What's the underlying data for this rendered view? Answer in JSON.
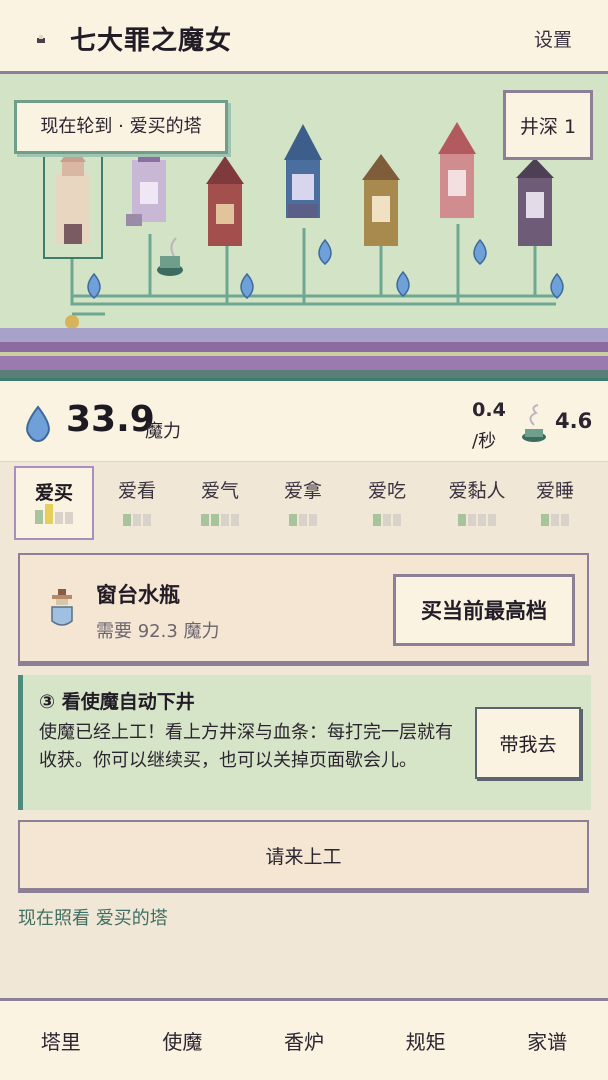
{
  "header": {
    "title": "七大罪之魔女",
    "settings_label": "设置"
  },
  "scene": {
    "turn_label": "现在轮到 · 爱买的塔",
    "depth_label": "井深 1"
  },
  "resources": {
    "mana_value": "33.9",
    "mana_unit": "魔力",
    "rate_value": "0.4",
    "rate_unit": "/秒",
    "incense_value": "4.6"
  },
  "tabs": [
    {
      "label": "爱买",
      "active": true
    },
    {
      "label": "爱看"
    },
    {
      "label": "爱气"
    },
    {
      "label": "爱拿"
    },
    {
      "label": "爱吃"
    },
    {
      "label": "爱黏人"
    },
    {
      "label": "爱睡"
    }
  ],
  "buy_card": {
    "item_name": "窗台水瓶",
    "need_text": "需要 92.3 魔力",
    "button_label": "买当前最高档"
  },
  "tip": {
    "title": "③ 看使魔自动下井",
    "body": "使魔已经上工！看上方井深与血条：每打完一层就有收获。你可以继续买，也可以关掉页面歇会儿。",
    "button_label": "带我去"
  },
  "hire_label": "请来上工",
  "viewing_text": "现在照看 爱买的塔",
  "bottom_nav": [
    "塔里",
    "使魔",
    "香炉",
    "规矩",
    "家谱"
  ],
  "colors": {
    "accent_teal": "#3e7d6c",
    "accent_purple": "#8d8096",
    "scene_bg": "#d3e3c6",
    "panel": "#fbf3e2"
  }
}
